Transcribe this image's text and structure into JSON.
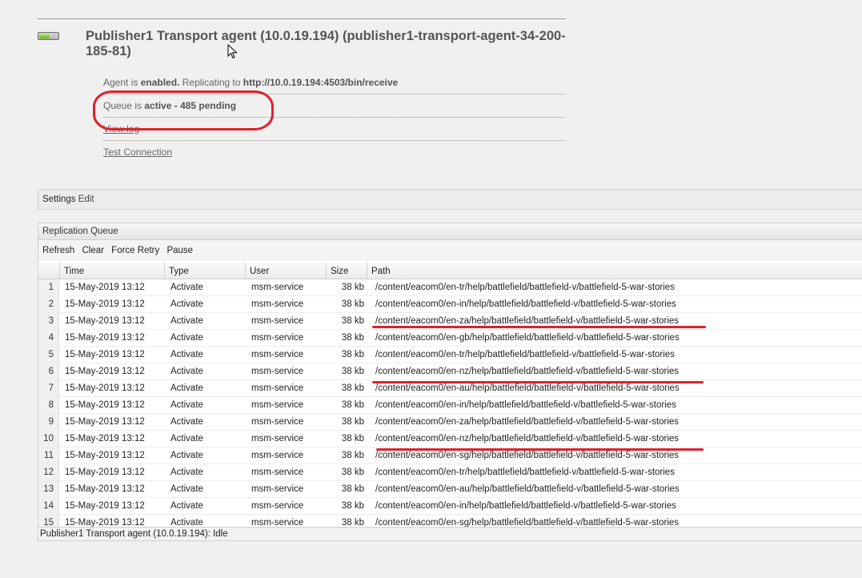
{
  "agent": {
    "title": "Publisher1 Transport agent (10.0.19.194) (publisher1-transport-agent-34-200-185-81)",
    "enabled_prefix": "Agent is",
    "enabled_state": "enabled.",
    "replicating_prefix": "Replicating to",
    "replicating_url": "http://10.0.19.194:4503/bin/receive",
    "queue_prefix": "Queue is",
    "queue_status": "active - 485 pending",
    "view_log": "View log",
    "test_connection": "Test Connection"
  },
  "settings": {
    "label": "Settings",
    "edit": "Edit"
  },
  "queue": {
    "title": "Replication Queue",
    "toolbar": [
      "Refresh",
      "Clear",
      "Force Retry",
      "Pause"
    ],
    "columns": [
      "Time",
      "Type",
      "User",
      "Size",
      "Path"
    ],
    "rows": [
      [
        "1",
        "15-May-2019 13:12",
        "Activate",
        "msm-service",
        "38 kb",
        "/content/eacom0/en-tr/help/battlefield/battlefield-v/battlefield-5-war-stories"
      ],
      [
        "2",
        "15-May-2019 13:12",
        "Activate",
        "msm-service",
        "38 kb",
        "/content/eacom0/en-in/help/battlefield/battlefield-v/battlefield-5-war-stories"
      ],
      [
        "3",
        "15-May-2019 13:12",
        "Activate",
        "msm-service",
        "38 kb",
        "/content/eacom0/en-za/help/battlefield/battlefield-v/battlefield-5-war-stories"
      ],
      [
        "4",
        "15-May-2019 13:12",
        "Activate",
        "msm-service",
        "38 kb",
        "/content/eacom0/en-gb/help/battlefield/battlefield-v/battlefield-5-war-stories"
      ],
      [
        "5",
        "15-May-2019 13:12",
        "Activate",
        "msm-service",
        "38 kb",
        "/content/eacom0/en-tr/help/battlefield/battlefield-v/battlefield-5-war-stories"
      ],
      [
        "6",
        "15-May-2019 13:12",
        "Activate",
        "msm-service",
        "38 kb",
        "/content/eacom0/en-nz/help/battlefield/battlefield-v/battlefield-5-war-stories"
      ],
      [
        "7",
        "15-May-2019 13:12",
        "Activate",
        "msm-service",
        "38 kb",
        "/content/eacom0/en-au/help/battlefield/battlefield-v/battlefield-5-war-stories"
      ],
      [
        "8",
        "15-May-2019 13:12",
        "Activate",
        "msm-service",
        "38 kb",
        "/content/eacom0/en-in/help/battlefield/battlefield-v/battlefield-5-war-stories"
      ],
      [
        "9",
        "15-May-2019 13:12",
        "Activate",
        "msm-service",
        "38 kb",
        "/content/eacom0/en-za/help/battlefield/battlefield-v/battlefield-5-war-stories"
      ],
      [
        "10",
        "15-May-2019 13:12",
        "Activate",
        "msm-service",
        "38 kb",
        "/content/eacom0/en-nz/help/battlefield/battlefield-v/battlefield-5-war-stories"
      ],
      [
        "11",
        "15-May-2019 13:12",
        "Activate",
        "msm-service",
        "38 kb",
        "/content/eacom0/en-sg/help/battlefield/battlefield-v/battlefield-5-war-stories"
      ],
      [
        "12",
        "15-May-2019 13:12",
        "Activate",
        "msm-service",
        "38 kb",
        "/content/eacom0/en-tr/help/battlefield/battlefield-v/battlefield-5-war-stories"
      ],
      [
        "13",
        "15-May-2019 13:12",
        "Activate",
        "msm-service",
        "38 kb",
        "/content/eacom0/en-au/help/battlefield/battlefield-v/battlefield-5-war-stories"
      ],
      [
        "14",
        "15-May-2019 13:12",
        "Activate",
        "msm-service",
        "38 kb",
        "/content/eacom0/en-in/help/battlefield/battlefield-v/battlefield-5-war-stories"
      ],
      [
        "15",
        "15-May-2019 13:12",
        "Activate",
        "msm-service",
        "38 kb",
        "/content/eacom0/en-sg/help/battlefield/battlefield-v/battlefield-5-war-stories"
      ]
    ]
  },
  "status_bar": "Publisher1 Transport agent (10.0.19.194): Idle",
  "annotation_color": "#e0202a",
  "enabled_color": "#63b51a"
}
